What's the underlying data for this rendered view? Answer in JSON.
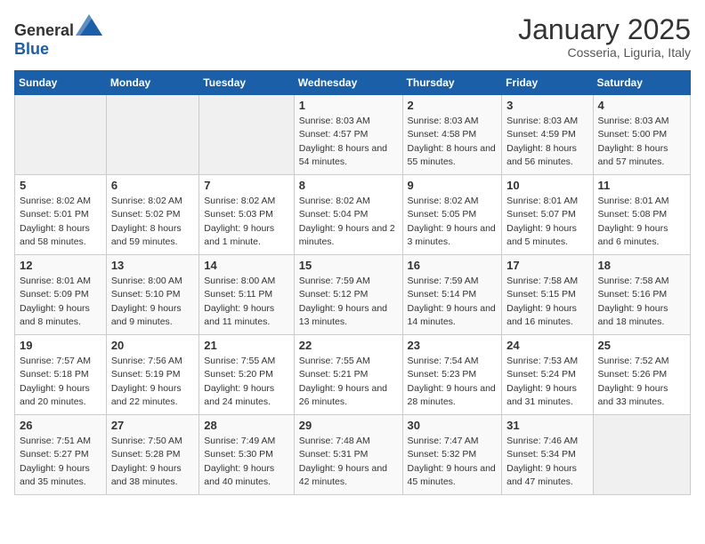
{
  "header": {
    "logo_general": "General",
    "logo_blue": "Blue",
    "title": "January 2025",
    "subtitle": "Cosseria, Liguria, Italy"
  },
  "days_of_week": [
    "Sunday",
    "Monday",
    "Tuesday",
    "Wednesday",
    "Thursday",
    "Friday",
    "Saturday"
  ],
  "weeks": [
    [
      {
        "day": "",
        "info": ""
      },
      {
        "day": "",
        "info": ""
      },
      {
        "day": "",
        "info": ""
      },
      {
        "day": "1",
        "info": "Sunrise: 8:03 AM\nSunset: 4:57 PM\nDaylight: 8 hours\nand 54 minutes."
      },
      {
        "day": "2",
        "info": "Sunrise: 8:03 AM\nSunset: 4:58 PM\nDaylight: 8 hours\nand 55 minutes."
      },
      {
        "day": "3",
        "info": "Sunrise: 8:03 AM\nSunset: 4:59 PM\nDaylight: 8 hours\nand 56 minutes."
      },
      {
        "day": "4",
        "info": "Sunrise: 8:03 AM\nSunset: 5:00 PM\nDaylight: 8 hours\nand 57 minutes."
      }
    ],
    [
      {
        "day": "5",
        "info": "Sunrise: 8:02 AM\nSunset: 5:01 PM\nDaylight: 8 hours\nand 58 minutes."
      },
      {
        "day": "6",
        "info": "Sunrise: 8:02 AM\nSunset: 5:02 PM\nDaylight: 8 hours\nand 59 minutes."
      },
      {
        "day": "7",
        "info": "Sunrise: 8:02 AM\nSunset: 5:03 PM\nDaylight: 9 hours\nand 1 minute."
      },
      {
        "day": "8",
        "info": "Sunrise: 8:02 AM\nSunset: 5:04 PM\nDaylight: 9 hours\nand 2 minutes."
      },
      {
        "day": "9",
        "info": "Sunrise: 8:02 AM\nSunset: 5:05 PM\nDaylight: 9 hours\nand 3 minutes."
      },
      {
        "day": "10",
        "info": "Sunrise: 8:01 AM\nSunset: 5:07 PM\nDaylight: 9 hours\nand 5 minutes."
      },
      {
        "day": "11",
        "info": "Sunrise: 8:01 AM\nSunset: 5:08 PM\nDaylight: 9 hours\nand 6 minutes."
      }
    ],
    [
      {
        "day": "12",
        "info": "Sunrise: 8:01 AM\nSunset: 5:09 PM\nDaylight: 9 hours\nand 8 minutes."
      },
      {
        "day": "13",
        "info": "Sunrise: 8:00 AM\nSunset: 5:10 PM\nDaylight: 9 hours\nand 9 minutes."
      },
      {
        "day": "14",
        "info": "Sunrise: 8:00 AM\nSunset: 5:11 PM\nDaylight: 9 hours\nand 11 minutes."
      },
      {
        "day": "15",
        "info": "Sunrise: 7:59 AM\nSunset: 5:12 PM\nDaylight: 9 hours\nand 13 minutes."
      },
      {
        "day": "16",
        "info": "Sunrise: 7:59 AM\nSunset: 5:14 PM\nDaylight: 9 hours\nand 14 minutes."
      },
      {
        "day": "17",
        "info": "Sunrise: 7:58 AM\nSunset: 5:15 PM\nDaylight: 9 hours\nand 16 minutes."
      },
      {
        "day": "18",
        "info": "Sunrise: 7:58 AM\nSunset: 5:16 PM\nDaylight: 9 hours\nand 18 minutes."
      }
    ],
    [
      {
        "day": "19",
        "info": "Sunrise: 7:57 AM\nSunset: 5:18 PM\nDaylight: 9 hours\nand 20 minutes."
      },
      {
        "day": "20",
        "info": "Sunrise: 7:56 AM\nSunset: 5:19 PM\nDaylight: 9 hours\nand 22 minutes."
      },
      {
        "day": "21",
        "info": "Sunrise: 7:55 AM\nSunset: 5:20 PM\nDaylight: 9 hours\nand 24 minutes."
      },
      {
        "day": "22",
        "info": "Sunrise: 7:55 AM\nSunset: 5:21 PM\nDaylight: 9 hours\nand 26 minutes."
      },
      {
        "day": "23",
        "info": "Sunrise: 7:54 AM\nSunset: 5:23 PM\nDaylight: 9 hours\nand 28 minutes."
      },
      {
        "day": "24",
        "info": "Sunrise: 7:53 AM\nSunset: 5:24 PM\nDaylight: 9 hours\nand 31 minutes."
      },
      {
        "day": "25",
        "info": "Sunrise: 7:52 AM\nSunset: 5:26 PM\nDaylight: 9 hours\nand 33 minutes."
      }
    ],
    [
      {
        "day": "26",
        "info": "Sunrise: 7:51 AM\nSunset: 5:27 PM\nDaylight: 9 hours\nand 35 minutes."
      },
      {
        "day": "27",
        "info": "Sunrise: 7:50 AM\nSunset: 5:28 PM\nDaylight: 9 hours\nand 38 minutes."
      },
      {
        "day": "28",
        "info": "Sunrise: 7:49 AM\nSunset: 5:30 PM\nDaylight: 9 hours\nand 40 minutes."
      },
      {
        "day": "29",
        "info": "Sunrise: 7:48 AM\nSunset: 5:31 PM\nDaylight: 9 hours\nand 42 minutes."
      },
      {
        "day": "30",
        "info": "Sunrise: 7:47 AM\nSunset: 5:32 PM\nDaylight: 9 hours\nand 45 minutes."
      },
      {
        "day": "31",
        "info": "Sunrise: 7:46 AM\nSunset: 5:34 PM\nDaylight: 9 hours\nand 47 minutes."
      },
      {
        "day": "",
        "info": ""
      }
    ]
  ]
}
